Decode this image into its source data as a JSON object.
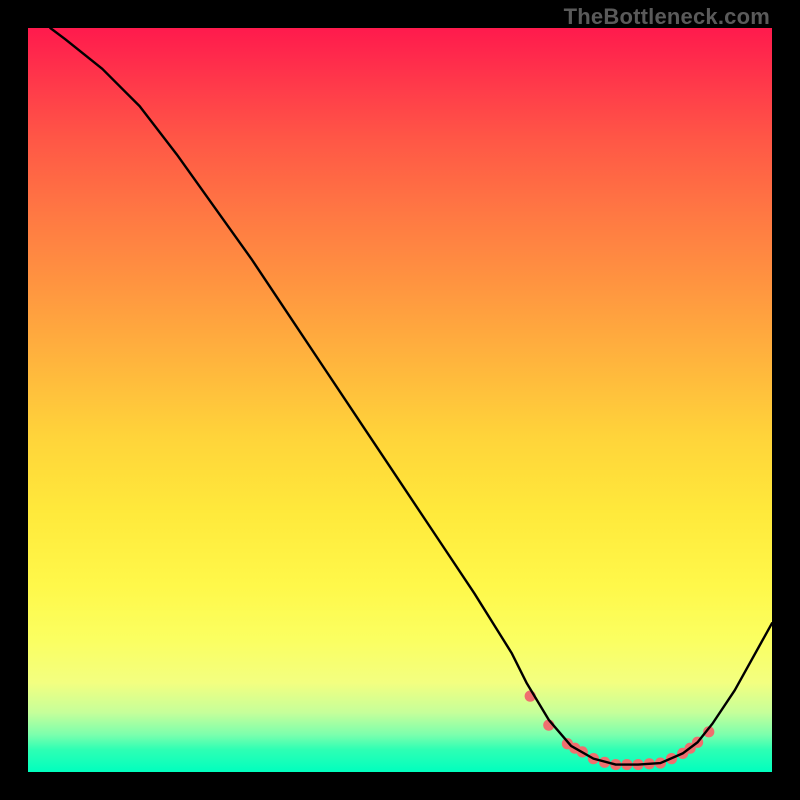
{
  "attribution": "TheBottleneck.com",
  "chart_data": {
    "type": "line",
    "title": "",
    "xlabel": "",
    "ylabel": "",
    "xlim": [
      0,
      100
    ],
    "ylim": [
      0,
      100
    ],
    "grid": false,
    "legend": false,
    "series": [
      {
        "name": "bottleneck-curve",
        "x": [
          3,
          5,
          10,
          15,
          20,
          25,
          30,
          35,
          40,
          45,
          50,
          55,
          60,
          65,
          67,
          70,
          73,
          76,
          79,
          82,
          85,
          88,
          90,
          92,
          95,
          100
        ],
        "y": [
          100,
          98.5,
          94.5,
          89.5,
          83,
          76,
          69,
          61.5,
          54,
          46.5,
          39,
          31.5,
          24,
          16,
          12,
          7,
          3.5,
          1.8,
          1,
          1,
          1.2,
          2.5,
          4,
          6.5,
          11,
          20
        ]
      }
    ],
    "markers": [
      {
        "name": "optimal-range-dots",
        "x": [
          67.5,
          70,
          72.5,
          73.5,
          74.5,
          76,
          77.5,
          79,
          80.5,
          82,
          83.5,
          85,
          86.5,
          88,
          89,
          90,
          91.5
        ],
        "y": [
          10.2,
          6.3,
          3.8,
          3.2,
          2.7,
          1.8,
          1.3,
          1.0,
          1.0,
          1.0,
          1.1,
          1.2,
          1.8,
          2.5,
          3.2,
          4.0,
          5.4
        ]
      }
    ],
    "colors": {
      "line": "#000000",
      "marker": "#ef6f6f"
    }
  }
}
